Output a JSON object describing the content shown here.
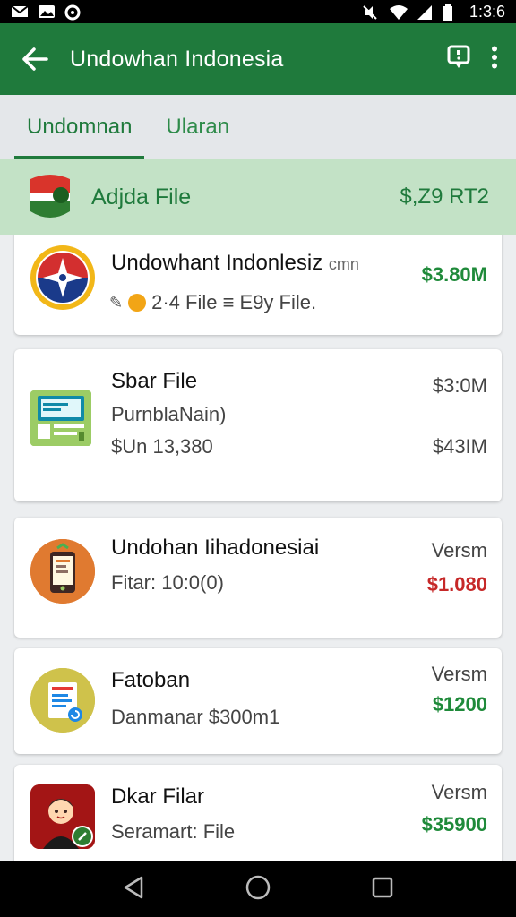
{
  "status": {
    "time": "1:3:6"
  },
  "app_bar": {
    "title": "Undowhan Indonesia"
  },
  "tabs": [
    {
      "label": "Undomnan"
    },
    {
      "label": "Ularan"
    }
  ],
  "banner": {
    "label": "Adjda File",
    "amount": "$,Z9 RT2"
  },
  "items": [
    {
      "name": "Undowhant Indonlesiz",
      "name_suffix": "cmn",
      "sub": "2·4 File ≡ E9y File.",
      "right_value": "$3.80M"
    },
    {
      "name": "Sbar File",
      "sub": "PurnblaNain)",
      "sub2": "$Un 13,380",
      "right_top": "$3:0M",
      "right_value": "$43IM"
    },
    {
      "name": "Undohan Iihadonesiai",
      "sub": "Fitar: 10:0(0)",
      "right_top": "Versm",
      "right_value": "$1.080"
    },
    {
      "name": "Fatoban",
      "sub": "Danmanar $300m1",
      "right_top": "Versm",
      "right_value": "$1200"
    },
    {
      "name": "Dkar Filar",
      "sub": "Seramart: File",
      "right_top": "Versm",
      "right_value": "$35900"
    }
  ],
  "colors": {
    "primary": "#1f7a3c",
    "banner": "#c3e2c6",
    "positive": "#1f8a3a",
    "negative": "#c62828"
  }
}
